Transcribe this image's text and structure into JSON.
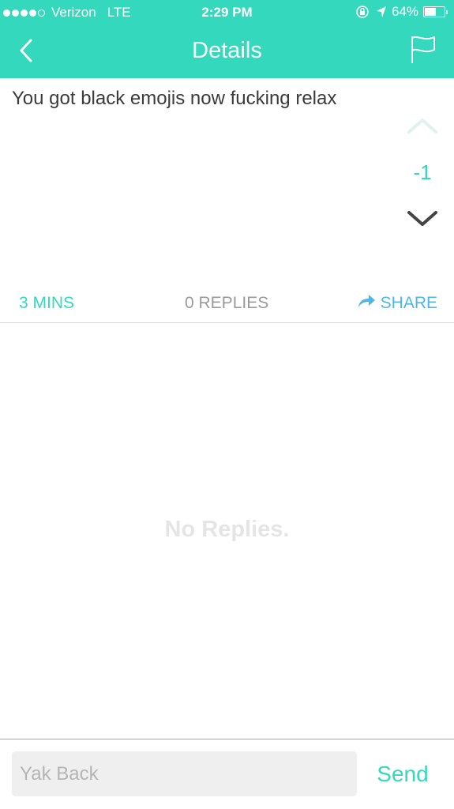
{
  "status_bar": {
    "carrier": "Verizon",
    "network": "LTE",
    "time": "2:29 PM",
    "battery": "64%",
    "battery_level": 0.64,
    "signal_bars_filled": 4,
    "signal_bars_total": 5
  },
  "nav": {
    "title": "Details",
    "back_icon": "chevron-left-icon",
    "flag_icon": "flag-icon"
  },
  "post": {
    "text": "You got black emojis now fucking relax",
    "score": "-1",
    "time": "3 MINS",
    "replies": "0 REPLIES",
    "share": "SHARE"
  },
  "replies": {
    "empty_text": "No Replies."
  },
  "reply_bar": {
    "placeholder": "Yak Back",
    "send_label": "Send"
  },
  "colors": {
    "accent": "#34d8bc",
    "share": "#4fb6e8",
    "text": "#3b3b3b",
    "muted": "#9a9a9a",
    "empty_state": "#e5e5e5"
  }
}
